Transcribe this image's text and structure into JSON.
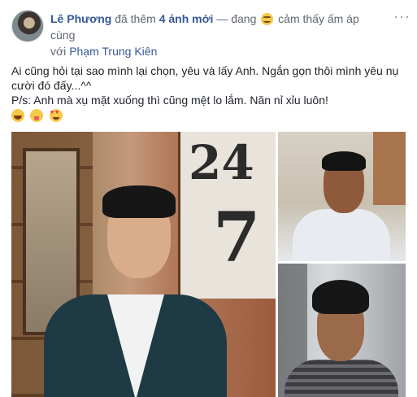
{
  "post": {
    "author": "Lê Phương",
    "action_prefix": "đã thêm ",
    "action_link": "4 ảnh mới",
    "action_suffix": " — đang",
    "feeling": "cảm thấy ấm áp cùng",
    "with_prefix": "với ",
    "tagged_person": "Phạm Trung Kiên",
    "more_menu": "···",
    "text_line1": "Ai cũng hỏi tại sao mình lại chọn, yêu và lấy Anh. Ngắn gọn thôi mình yêu nụ cười đó đấy...^^",
    "text_line2": "P/s: Anh mà xụ mặt xuống thì cũng mệt lo lắm. Năn nỉ xỉu luôn!",
    "emojis": [
      "laughing-emoji",
      "tongue-emoji",
      "heart-eyes-emoji"
    ],
    "sign_number_top": "24",
    "sign_number_bottom": "7"
  },
  "photos": [
    {
      "name": "main-photo",
      "icon": "photo-man-suit"
    },
    {
      "name": "top-right-photo",
      "icon": "photo-man-smiling"
    },
    {
      "name": "bottom-right-photo",
      "icon": "photo-man-striped-shirt"
    }
  ]
}
